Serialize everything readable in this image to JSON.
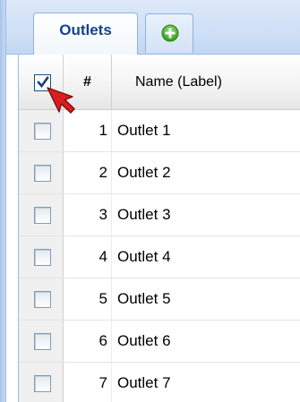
{
  "tabs": [
    {
      "label": "Outlets",
      "active": true
    },
    {
      "icon": "add-circle-icon",
      "color": "#3fae2a"
    }
  ],
  "grid": {
    "columns": {
      "select_all_checked": true,
      "number_header": "#",
      "name_header": "Name (Label)"
    },
    "rows": [
      {
        "number": "1",
        "name": "Outlet 1",
        "checked": false
      },
      {
        "number": "2",
        "name": "Outlet 2",
        "checked": false
      },
      {
        "number": "3",
        "name": "Outlet 3",
        "checked": false
      },
      {
        "number": "4",
        "name": "Outlet 4",
        "checked": false
      },
      {
        "number": "5",
        "name": "Outlet 5",
        "checked": false
      },
      {
        "number": "6",
        "name": "Outlet 6",
        "checked": false
      },
      {
        "number": "7",
        "name": "Outlet 7",
        "checked": false
      }
    ]
  },
  "pointer": {
    "icon": "arrow-cursor-icon",
    "color": "#d81e1e"
  }
}
